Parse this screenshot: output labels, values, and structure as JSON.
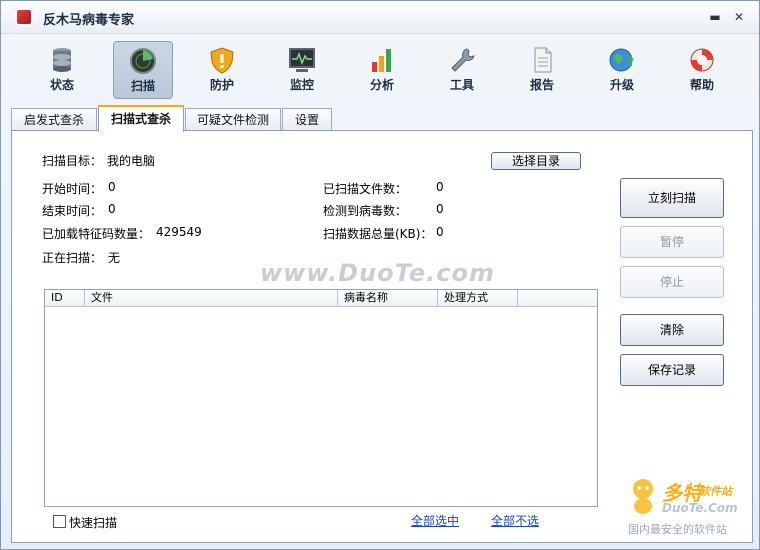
{
  "window": {
    "title": "反木马病毒专家",
    "minimize": "▬",
    "close": "✕"
  },
  "toolbar": {
    "items": [
      {
        "label": "状态",
        "icon": "database-icon"
      },
      {
        "label": "扫描",
        "icon": "radar-icon",
        "active": true
      },
      {
        "label": "防护",
        "icon": "shield-icon"
      },
      {
        "label": "监控",
        "icon": "monitor-icon"
      },
      {
        "label": "分析",
        "icon": "bar-chart-icon"
      },
      {
        "label": "工具",
        "icon": "wrench-icon"
      },
      {
        "label": "报告",
        "icon": "report-icon"
      },
      {
        "label": "升级",
        "icon": "upgrade-icon"
      },
      {
        "label": "帮助",
        "icon": "lifebuoy-icon"
      }
    ]
  },
  "tabs": [
    {
      "label": "启发式查杀"
    },
    {
      "label": "扫描式查杀",
      "active": true
    },
    {
      "label": "可疑文件检测"
    },
    {
      "label": "设置"
    }
  ],
  "scan": {
    "target_label": "扫描目标：",
    "target_value": "我的电脑",
    "choose_dir": "选择目录",
    "start_time_label": "开始时间：",
    "start_time_value": "0",
    "end_time_label": "结束时间：",
    "end_time_value": "0",
    "loaded_sigs_label": "已加载特征码数量：",
    "loaded_sigs_value": "429549",
    "scanning_label": "正在扫描：",
    "scanning_value": "无",
    "scanned_files_label": "已扫描文件数：",
    "scanned_files_value": "0",
    "viruses_found_label": "检测到病毒数：",
    "viruses_found_value": "0",
    "data_total_label": "扫描数据总量(KB)：",
    "data_total_value": "0"
  },
  "actions": {
    "scan_now": "立刻扫描",
    "pause": "暂停",
    "stop": "停止",
    "clear": "清除",
    "save_log": "保存记录"
  },
  "results_table": {
    "columns": [
      "ID",
      "文件",
      "病毒名称",
      "处理方式"
    ],
    "rows": []
  },
  "footer": {
    "quick_scan": "快速扫描",
    "select_all": "全部选中",
    "select_none": "全部不选"
  },
  "watermark": {
    "site": "www.DuoTe.com",
    "brand_main": "多特",
    "brand_sub": "软件站",
    "brand_url": "DuoTe.Com",
    "brand_slogan": "国内最安全的软件站"
  },
  "colors": {
    "accent_tab": "#f5a623",
    "link": "#1f46b0",
    "brand": "#f3b11a"
  }
}
